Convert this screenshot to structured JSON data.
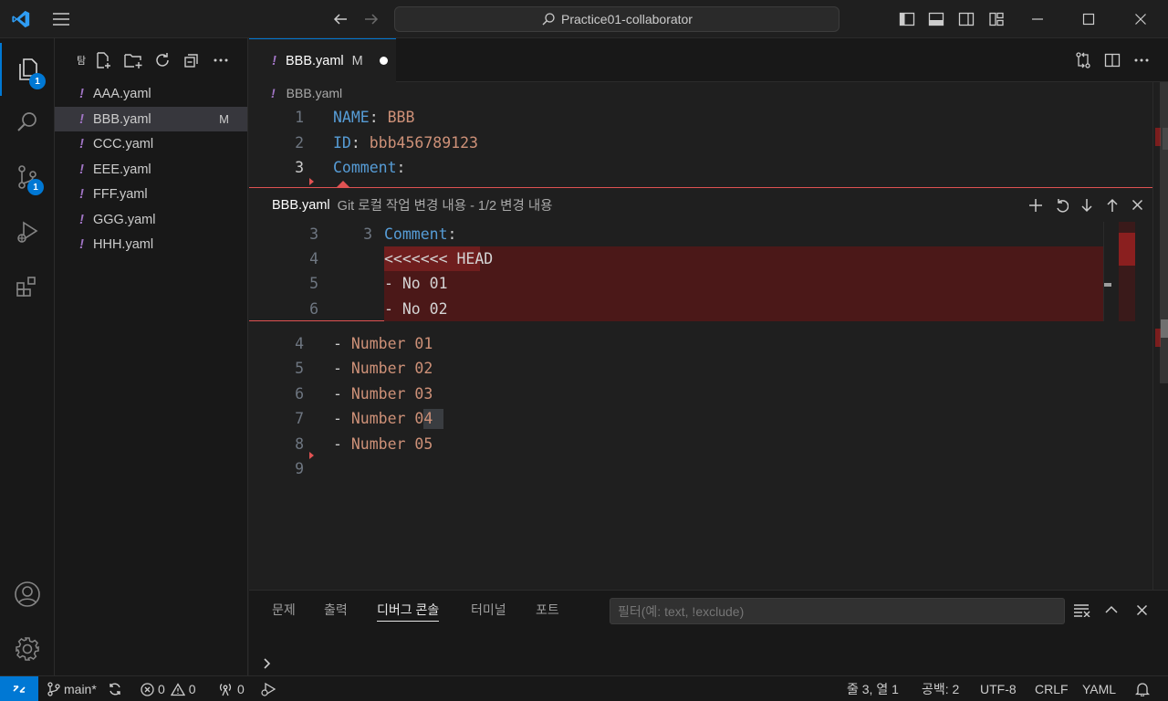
{
  "window": {
    "title": "Practice01-collaborator"
  },
  "activity": {
    "explorer_badge": "1",
    "scm_badge": "1"
  },
  "explorer": {
    "files": [
      {
        "name": "AAA.yaml",
        "status": ""
      },
      {
        "name": "BBB.yaml",
        "status": "M"
      },
      {
        "name": "CCC.yaml",
        "status": ""
      },
      {
        "name": "EEE.yaml",
        "status": ""
      },
      {
        "name": "FFF.yaml",
        "status": ""
      },
      {
        "name": "GGG.yaml",
        "status": ""
      },
      {
        "name": "HHH.yaml",
        "status": ""
      }
    ]
  },
  "editor": {
    "tab": {
      "label": "BBB.yaml",
      "status": "M"
    },
    "breadcrumb": "BBB.yaml",
    "lines_top": [
      {
        "num": "1",
        "key": "NAME",
        "sep": ": ",
        "value": "BBB"
      },
      {
        "num": "2",
        "key": "ID",
        "sep": ": ",
        "value": "bbb456789123"
      },
      {
        "num": "3",
        "key": "Comment",
        "sep": ":",
        "value": ""
      }
    ],
    "peek": {
      "file": "BBB.yaml",
      "description": "Git 로컬 작업 변경 내용 - 1/2 변경 내용",
      "lines": [
        {
          "old": "3",
          "new": "3",
          "key": "Comment",
          "text": ":",
          "deleted": false
        },
        {
          "old": "4",
          "new": "",
          "text": "<<<<<<< HEAD",
          "deleted": true
        },
        {
          "old": "5",
          "new": "",
          "text": "- No 01",
          "deleted": true
        },
        {
          "old": "6",
          "new": "",
          "text": "- No 02",
          "deleted": true
        }
      ]
    },
    "lines_bottom": [
      {
        "num": "4",
        "dash": "- ",
        "value": "Number 01"
      },
      {
        "num": "5",
        "dash": "- ",
        "value": "Number 02"
      },
      {
        "num": "6",
        "dash": "- ",
        "value": "Number 03"
      },
      {
        "num": "7",
        "dash": "- ",
        "value": "Number 04"
      },
      {
        "num": "8",
        "dash": "- ",
        "value": "Number 05"
      },
      {
        "num": "9",
        "dash": "",
        "value": ""
      }
    ]
  },
  "panel": {
    "tabs": [
      "문제",
      "출력",
      "디버그 콘솔",
      "터미널",
      "포트"
    ],
    "active_tab": "디버그 콘솔",
    "filter_placeholder": "필터(예: text, !exclude)"
  },
  "statusbar": {
    "branch": "main*",
    "errors": "0",
    "warnings": "0",
    "ports": "0",
    "position": "줄 3, 열 1",
    "spaces": "공백: 2",
    "encoding": "UTF-8",
    "eol": "CRLF",
    "language": "YAML"
  },
  "colors": {
    "accent": "#0078d4",
    "deleted_bg": "#4b1818",
    "diff_border": "#e05252",
    "yaml_key": "#569cd6",
    "yaml_value": "#ce9178"
  }
}
